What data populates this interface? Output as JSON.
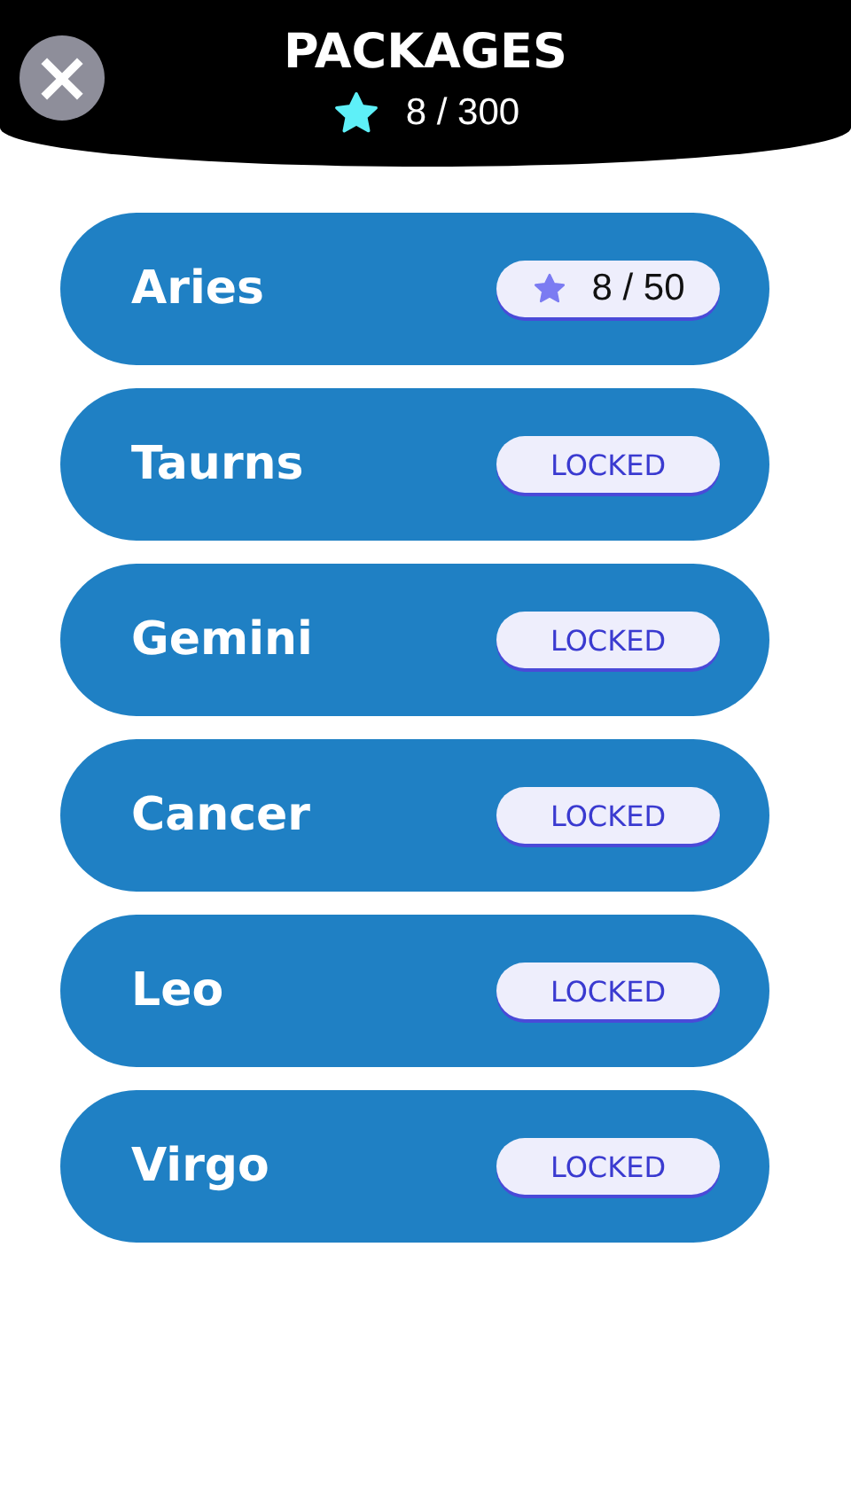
{
  "header": {
    "close": "×",
    "title": "PACKAGES",
    "stars": "8 / 300"
  },
  "packages": [
    {
      "name": "Aries",
      "kind": "progress",
      "badge": "8 / 50"
    },
    {
      "name": "Taurns",
      "kind": "locked",
      "badge": "LOCKED"
    },
    {
      "name": "Gemini",
      "kind": "locked",
      "badge": "LOCKED"
    },
    {
      "name": "Cancer",
      "kind": "locked",
      "badge": "LOCKED"
    },
    {
      "name": "Leo",
      "kind": "locked",
      "badge": "LOCKED"
    },
    {
      "name": "Virgo",
      "kind": "locked",
      "badge": "LOCKED"
    }
  ]
}
